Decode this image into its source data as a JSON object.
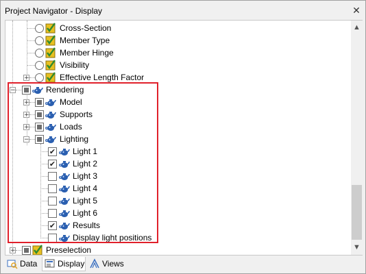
{
  "window": {
    "title": "Project Navigator - Display",
    "close": "✕"
  },
  "tree": {
    "items": [
      {
        "label": "Cross-Section",
        "control": "radio",
        "icon": "check-icon"
      },
      {
        "label": "Member Type",
        "control": "radio",
        "icon": "check-icon"
      },
      {
        "label": "Member Hinge",
        "control": "radio",
        "icon": "check-icon"
      },
      {
        "label": "Visibility",
        "control": "radio",
        "icon": "check-icon"
      },
      {
        "label": "Effective Length Factor",
        "control": "radio",
        "icon": "check-icon"
      },
      {
        "label": "Rendering",
        "control": "partial",
        "icon": "teapot-icon"
      },
      {
        "label": "Model",
        "control": "partial",
        "icon": "teapot-icon"
      },
      {
        "label": "Supports",
        "control": "partial",
        "icon": "teapot-icon"
      },
      {
        "label": "Loads",
        "control": "partial",
        "icon": "teapot-icon"
      },
      {
        "label": "Lighting",
        "control": "partial",
        "icon": "teapot-icon"
      },
      {
        "label": "Light 1",
        "control": "checked",
        "icon": "teapot-icon"
      },
      {
        "label": "Light 2",
        "control": "checked",
        "icon": "teapot-icon"
      },
      {
        "label": "Light 3",
        "control": "unchecked",
        "icon": "teapot-icon"
      },
      {
        "label": "Light 4",
        "control": "unchecked",
        "icon": "teapot-icon"
      },
      {
        "label": "Light 5",
        "control": "unchecked",
        "icon": "teapot-icon"
      },
      {
        "label": "Light 6",
        "control": "unchecked",
        "icon": "teapot-icon"
      },
      {
        "label": "Results",
        "control": "checked",
        "icon": "teapot-icon"
      },
      {
        "label": "Display light positions",
        "control": "unchecked",
        "icon": "teapot-icon"
      },
      {
        "label": "Preselection",
        "control": "partial",
        "icon": "check-icon"
      }
    ]
  },
  "tabs": [
    {
      "label": "Data",
      "icon": "data-icon"
    },
    {
      "label": "Display",
      "icon": "display-icon",
      "active": true
    },
    {
      "label": "Views",
      "icon": "views-icon"
    }
  ],
  "colors": {
    "highlight_border": "#e0202a",
    "teapot": "#2a5fb0",
    "check_green": "#3a9a3a",
    "check_yellow": "#e8c020"
  }
}
